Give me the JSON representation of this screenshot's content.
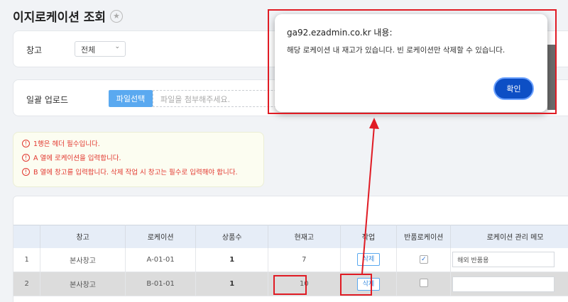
{
  "page": {
    "title": "이지로케이션 조회"
  },
  "filters": {
    "warehouse_label": "창고",
    "warehouse_value": "전체",
    "upload_label": "일괄 업로드",
    "file_button": "파일선택",
    "file_placeholder": "파일을 첨부해주세요."
  },
  "notices": [
    "1행은 헤더 필수입니다.",
    "A 열에 로케이션을 입력합니다.",
    "B 열에 창고를 입력합니다. 삭제 작업 시 창고는 필수로 입력해야 합니다."
  ],
  "table": {
    "headers": [
      "",
      "창고",
      "로케이션",
      "상품수",
      "현재고",
      "작업",
      "반품로케이션",
      "로케이션 관리 메모"
    ],
    "rows": [
      {
        "no": "1",
        "warehouse": "본사창고",
        "location": "A-01-01",
        "products": "1",
        "stock": "7",
        "action": "삭제",
        "return_checked": true,
        "memo": "해외 반품용"
      },
      {
        "no": "2",
        "warehouse": "본사창고",
        "location": "B-01-01",
        "products": "1",
        "stock": "10",
        "action": "삭제",
        "return_checked": false,
        "memo": ""
      }
    ]
  },
  "dialog": {
    "title": "ga92.ezadmin.co.kr 내용:",
    "message": "해당 로케이션 내 재고가 있습니다. 빈 로케이션만 삭제할 수 있습니다.",
    "ok_label": "확인"
  },
  "colors": {
    "accent": "#5aa9f0",
    "highlight": "#e01b24",
    "dialog_button": "#0d4fc5",
    "notice_text": "#e2372f"
  }
}
